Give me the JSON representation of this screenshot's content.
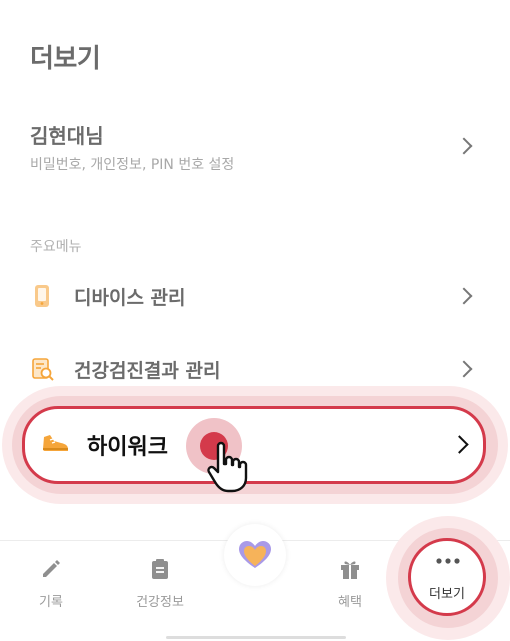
{
  "page": {
    "title": "더보기"
  },
  "profile": {
    "name": "김현대님",
    "subtitle": "비밀번호, 개인정보, PIN 번호 설정"
  },
  "main_menu": {
    "section_label": "주요메뉴",
    "items": [
      {
        "label": "디바이스 관리",
        "icon": "phone-icon"
      },
      {
        "label": "건강검진결과 관리",
        "icon": "report-search-icon"
      },
      {
        "label": "하이워크",
        "icon": "sneaker-icon",
        "highlighted": true
      }
    ]
  },
  "bottom_nav": {
    "items": [
      {
        "label": "기록",
        "icon": "pencil-icon"
      },
      {
        "label": "건강정보",
        "icon": "clipboard-icon"
      },
      {
        "label": "",
        "icon": "heart-icon"
      },
      {
        "label": "혜택",
        "icon": "gift-icon"
      },
      {
        "label": "더보기",
        "icon": "more-dots-icon",
        "active": true
      }
    ]
  },
  "colors": {
    "accent": "#d43a4b",
    "icon_orange": "#f5a53a",
    "text_gray": "#6b6b6b"
  }
}
